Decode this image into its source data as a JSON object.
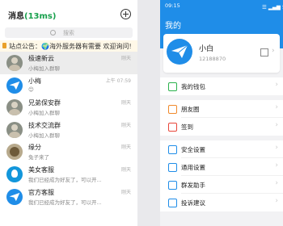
{
  "messages": {
    "title": "消息",
    "count": "(13ms)",
    "search_placeholder": "搜索",
    "notice": "站点公告：🌍海外服务器有需要 欢迎询问!",
    "conversations": [
      {
        "name": "极速新云",
        "subtitle": "小梅加入群聊",
        "time": "刚天",
        "avatar": "photo",
        "selected": true
      },
      {
        "name": "小梅",
        "subtitle": "😊",
        "time": "上午 07:59",
        "avatar": "plane",
        "selected": false
      },
      {
        "name": "兄弟保安群",
        "subtitle": "小梅加入群聊",
        "time": "刚天",
        "avatar": "photo",
        "selected": false
      },
      {
        "name": "技术交流群",
        "subtitle": "小梅加入群聊",
        "time": "刚天",
        "avatar": "photo",
        "selected": false
      },
      {
        "name": "缘分",
        "subtitle": "兔子来了",
        "time": "刚天",
        "avatar": "cat",
        "selected": false
      },
      {
        "name": "美女客服",
        "subtitle": "我们已经成为好友了，可以开...",
        "time": "刚天",
        "avatar": "qq",
        "selected": false
      },
      {
        "name": "官方客服",
        "subtitle": "我们已经成为好友了，可以开...",
        "time": "刚天",
        "avatar": "plane",
        "selected": false
      }
    ]
  },
  "profile_screen": {
    "status_time": "09:15",
    "status_right": "☰ ▂▄▆ 5G 〓",
    "title": "我的",
    "user": {
      "name": "小白",
      "number": "12188870"
    },
    "groups": [
      [
        {
          "label": "我的钱包",
          "icon": "wallet-icon",
          "color": "#2bb24c"
        }
      ],
      [
        {
          "label": "朋友圈",
          "icon": "moments-icon",
          "color": "#f08a2c"
        },
        {
          "label": "签到",
          "icon": "signin-icon",
          "color": "#e8463a"
        }
      ],
      [
        {
          "label": "安全设置",
          "icon": "shield-icon",
          "color": "#1f8de8"
        },
        {
          "label": "通用设置",
          "icon": "gear-icon",
          "color": "#1f8de8"
        },
        {
          "label": "群发助手",
          "icon": "broadcast-icon",
          "color": "#1f8de8"
        },
        {
          "label": "投诉建议",
          "icon": "feedback-icon",
          "color": "#1f8de8"
        }
      ]
    ]
  }
}
